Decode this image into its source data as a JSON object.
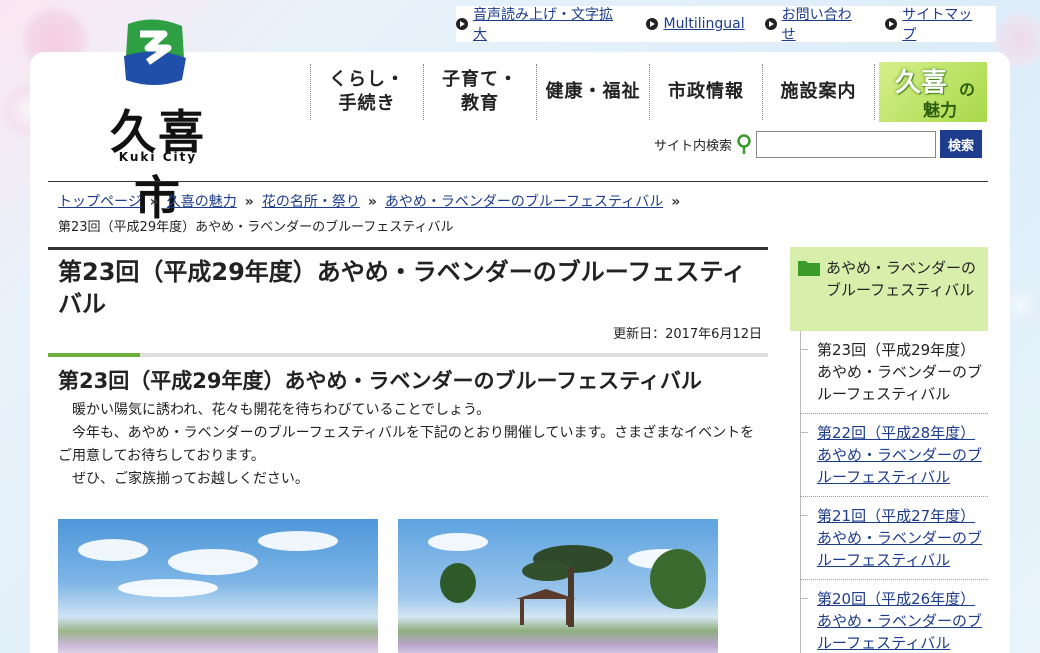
{
  "utility": {
    "links": [
      {
        "label": "音声読み上げ・文字拡大"
      },
      {
        "label": "Multilingual"
      },
      {
        "label": "お問い合わせ"
      },
      {
        "label": "サイトマップ"
      }
    ]
  },
  "logo": {
    "title": "久喜市",
    "subtitle": "Kuki City"
  },
  "gnav": {
    "items": [
      {
        "line1": "くらし・",
        "line2": "手続き"
      },
      {
        "line1": "子育て・",
        "line2": "教育"
      },
      {
        "line1": "健康・福祉",
        "line2": ""
      },
      {
        "line1": "市政情報",
        "line2": ""
      },
      {
        "line1": "施設案内",
        "line2": ""
      }
    ],
    "special": {
      "big": "久喜",
      "no": "の",
      "miryoku": "魅力"
    }
  },
  "search": {
    "label": "サイト内検索",
    "placeholder": "",
    "button": "検索"
  },
  "breadcrumb": {
    "links": [
      "トップページ",
      "久喜の魅力",
      "花の名所・祭り",
      "あやめ・ラベンダーのブルーフェスティバル"
    ],
    "current": "第23回（平成29年度）あやめ・ラベンダーのブルーフェスティバル"
  },
  "main": {
    "title": "第23回（平成29年度）あやめ・ラベンダーのブルーフェスティバル",
    "updated": "更新日：2017年6月12日",
    "h2": "第23回（平成29年度）あやめ・ラベンダーのブルーフェスティバル",
    "paragraphs": [
      "暖かい陽気に誘われ、花々も開花を待ちわびていることでしょう。",
      "今年も、あやめ・ラベンダーのブルーフェスティバルを下記のとおり開催しています。さまざまなイベントをご用意してお待ちしております。",
      "ぜひ、ご家族揃ってお越しください。"
    ]
  },
  "side": {
    "heading": "あやめ・ラベンダーのブルーフェスティバル",
    "items": [
      {
        "label": "第23回（平成29年度）あやめ・ラベンダーのブルーフェスティバル"
      },
      {
        "label": "第22回（平成28年度）あやめ・ラベンダーのブルーフェスティバル"
      },
      {
        "label": "第21回（平成27年度）あやめ・ラベンダーのブルーフェスティバル"
      },
      {
        "label": "第20回（平成26年度）あやめ・ラベンダーのブルーフェスティバル"
      }
    ]
  },
  "colors": {
    "link": "#1d3c8c",
    "accent_green": "#6fae3a",
    "side_head": "#d8efac"
  }
}
